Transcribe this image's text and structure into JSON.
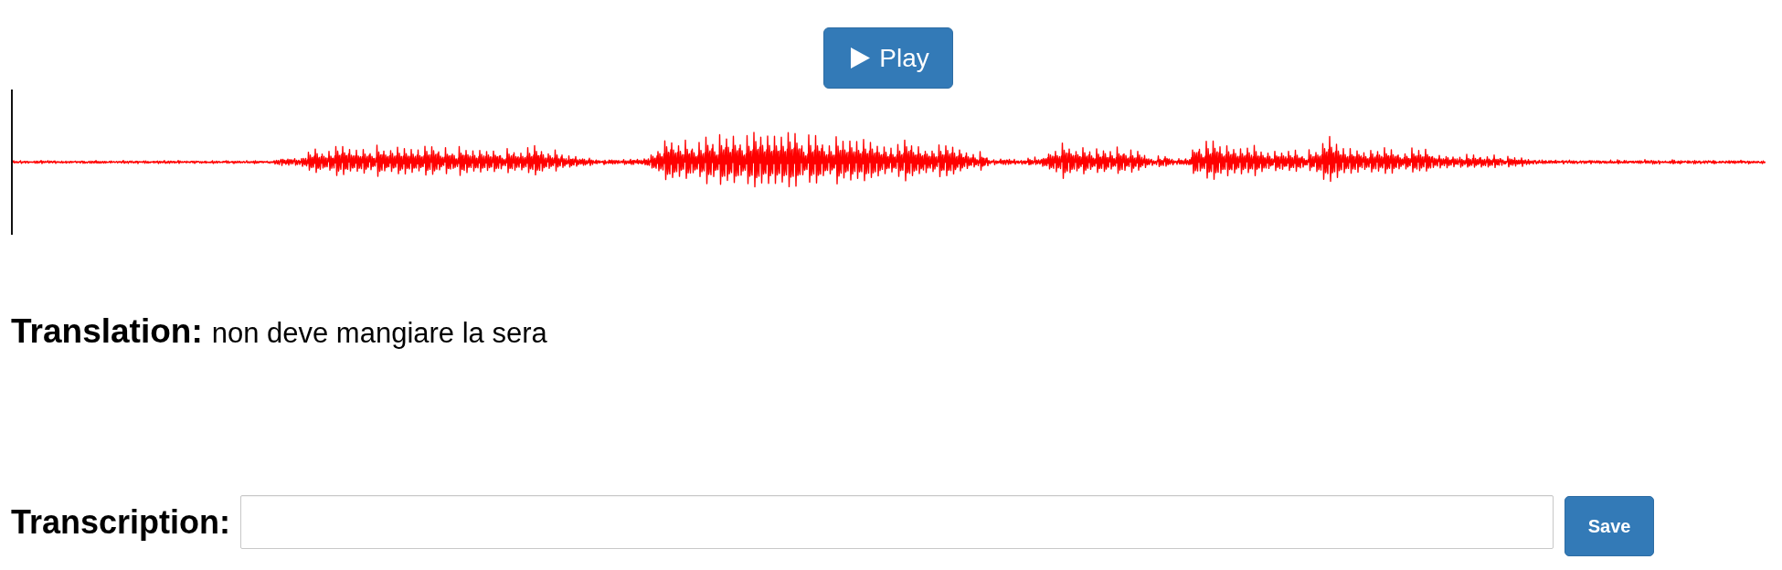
{
  "player": {
    "play_button": {
      "label": "Play"
    }
  },
  "translation": {
    "label": "Translation:",
    "text": "non deve mangiare la sera"
  },
  "transcription": {
    "label": "Transcription:",
    "save_button": {
      "label": "Save"
    }
  }
}
